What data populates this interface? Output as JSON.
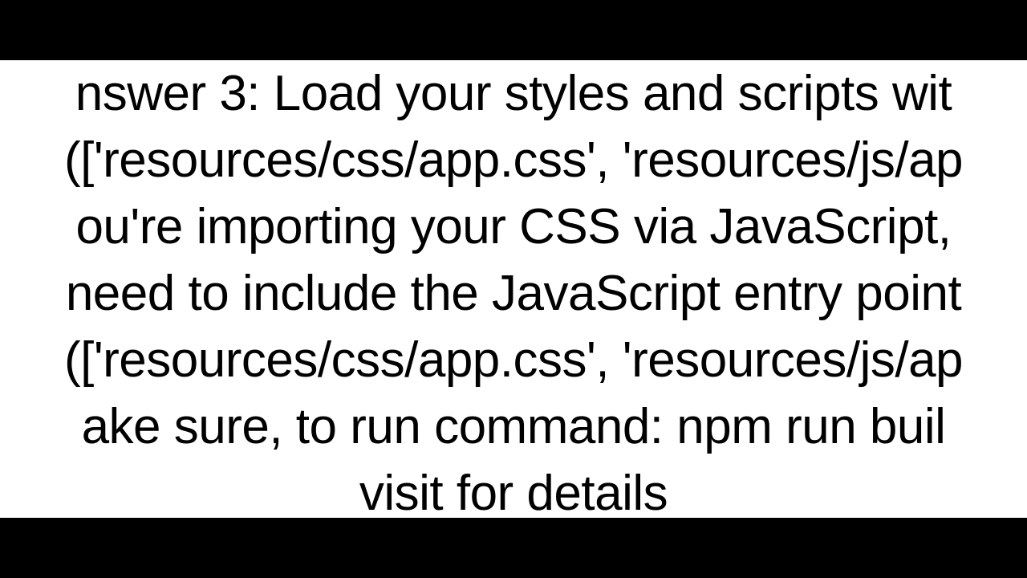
{
  "answer": {
    "lines": [
      "nswer 3: Load your styles and scripts wit",
      "(['resources/css/app.css', 'resources/js/ap",
      "ou're importing your CSS via JavaScript,",
      "need to include the JavaScript entry point",
      "(['resources/css/app.css', 'resources/js/ap",
      "ake sure, to run command: npm run buil",
      "visit for details"
    ]
  }
}
